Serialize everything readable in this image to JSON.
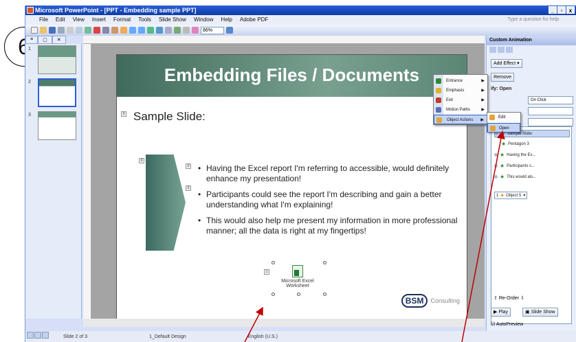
{
  "window": {
    "title": "Microsoft PowerPoint - [PPT - Embedding sample PPT]",
    "controls": [
      "_",
      "▫",
      "x"
    ]
  },
  "menubar": {
    "items": [
      "File",
      "Edit",
      "View",
      "Insert",
      "Format",
      "Tools",
      "Slide Show",
      "Window",
      "Help",
      "Adobe PDF"
    ],
    "help_placeholder": "Type a question for help"
  },
  "toolbar": {
    "zoom": "86%"
  },
  "callout": {
    "step": "6"
  },
  "thumbnails": {
    "numbers": [
      "1",
      "2",
      "3"
    ]
  },
  "slide": {
    "title": "Embedding Files / Documents",
    "subtitle": "Sample Slide:",
    "bullets": [
      "Having the Excel report I'm referring to accessible, would definitely enhance my presentation!",
      "Participants could see the report I'm describing and gain a better understanding what I'm explaining!",
      "This would also help me present my information in more professional manner; all the data is right at my fingertips!"
    ],
    "object_label": "Microsoft Excel Worksheet",
    "logo_mark": "BSM",
    "logo_text": "Consulting",
    "tags": [
      "0",
      "0",
      "0",
      "0",
      "1"
    ]
  },
  "statusbar": {
    "slide": "Slide 2 of 3",
    "design": "1_Default Design",
    "language": "English (U.S.)"
  },
  "taskpane": {
    "title": "Custom Animation",
    "add_effect": "Add Effect ▾",
    "remove": "Remove",
    "modify_label": "ify: Open",
    "start_value": "On Click",
    "animations": [
      "Sample Slide:",
      "Pentagon 3",
      "Having the Ex...",
      "Participants c...",
      "This would als..."
    ],
    "object_row": "Object 5",
    "object_num": "1",
    "reorder": "Re-Order",
    "play": "Play",
    "slideshow": "Slide Show",
    "autopreview": "AutoPreview"
  },
  "context_menu": {
    "items": [
      "Entrance",
      "Emphasis",
      "Exit",
      "Motion Paths",
      "Object Actions"
    ],
    "icon_colors": [
      "#2d8a2d",
      "#e1b12a",
      "#c23b2a",
      "#5b6fb5",
      "#e1a33a"
    ],
    "submenu": [
      "Edit",
      "Open"
    ]
  }
}
